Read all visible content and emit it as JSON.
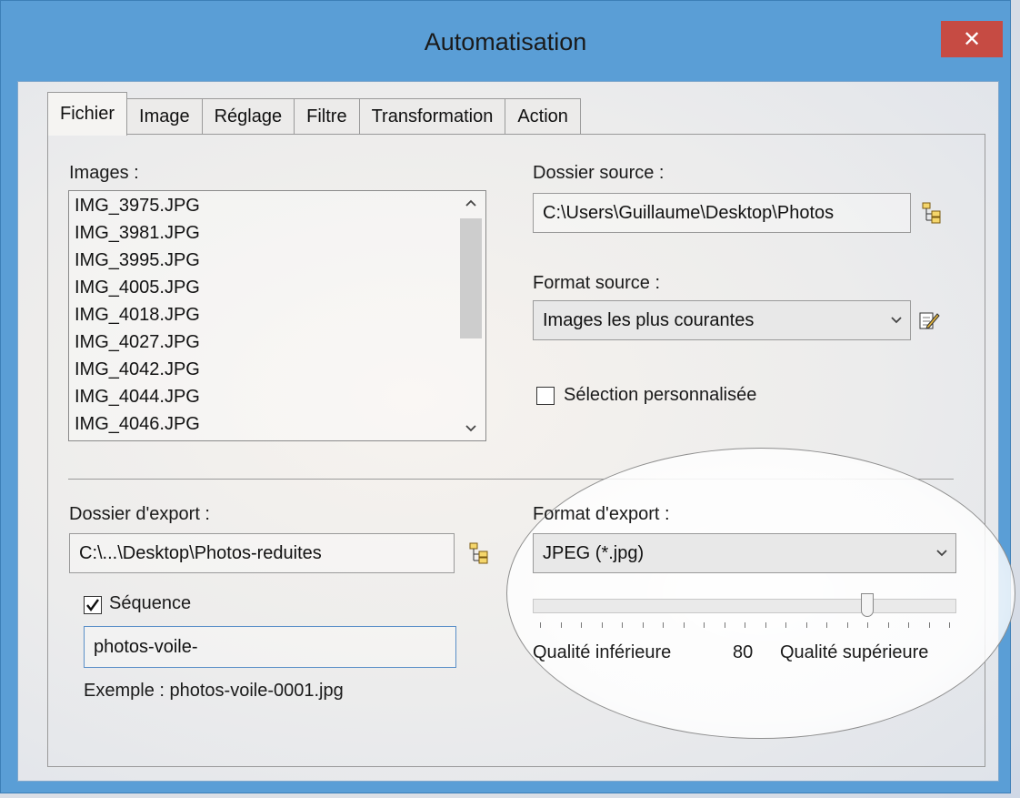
{
  "window": {
    "title": "Automatisation",
    "close_glyph": "✕"
  },
  "tabs": [
    "Fichier",
    "Image",
    "Réglage",
    "Filtre",
    "Transformation",
    "Action"
  ],
  "images": {
    "label": "Images :",
    "items": [
      "IMG_3975.JPG",
      "IMG_3981.JPG",
      "IMG_3995.JPG",
      "IMG_4005.JPG",
      "IMG_4018.JPG",
      "IMG_4027.JPG",
      "IMG_4042.JPG",
      "IMG_4044.JPG",
      "IMG_4046.JPG"
    ],
    "scroll_up": "^",
    "scroll_down": "v"
  },
  "source": {
    "folder_label": "Dossier source :",
    "folder_value": "C:\\Users\\Guillaume\\Desktop\\Photos",
    "format_label": "Format source :",
    "format_value": "Images les plus courantes",
    "custom_selection_label": "Sélection personnalisée"
  },
  "export": {
    "folder_label": "Dossier d'export :",
    "folder_value": "C:\\...\\Desktop\\Photos-reduites",
    "sequence_label": "Séquence",
    "sequence_value": "photos-voile-",
    "example_text": "Exemple : photos-voile-0001.jpg",
    "format_label": "Format d'export :",
    "format_value": "JPEG (*.jpg)",
    "quality_low_label": "Qualité inférieure",
    "quality_value": "80",
    "quality_high_label": "Qualité supérieure"
  },
  "icons": {
    "folder": "folder-tree-icon",
    "edit": "edit-icon"
  },
  "colors": {
    "title_bar": "#5a9ed6",
    "close": "#c64b43"
  }
}
